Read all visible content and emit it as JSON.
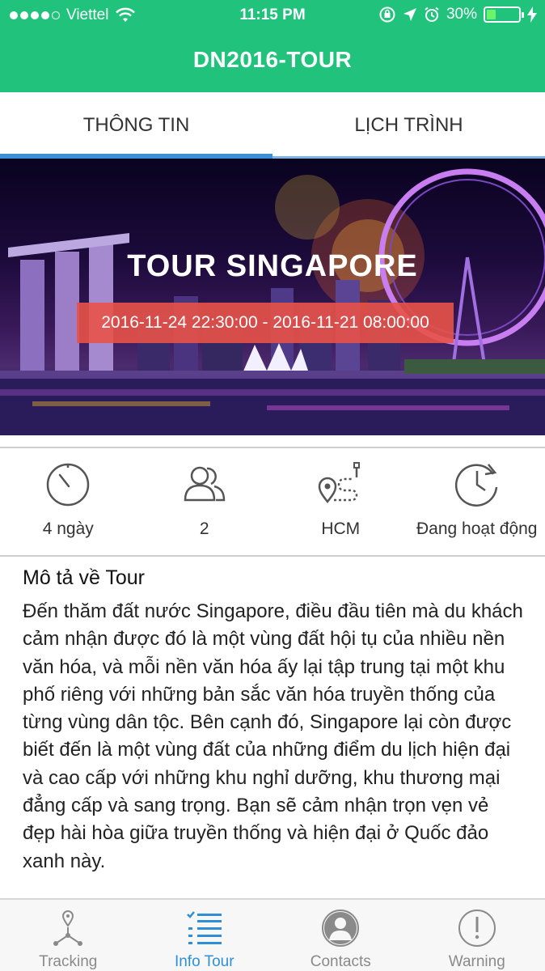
{
  "status_bar": {
    "carrier": "Viettel",
    "time": "11:15 PM",
    "battery_percent": "30%",
    "battery_level": 0.3,
    "signal_bars_filled": 4,
    "signal_bars_total": 5
  },
  "header": {
    "title": "DN2016-TOUR"
  },
  "tabs": [
    {
      "label": "THÔNG TIN",
      "active": true
    },
    {
      "label": "LỊCH TRÌNH",
      "active": false
    }
  ],
  "hero": {
    "title": "TOUR SINGAPORE",
    "dates": "2016-11-24 22:30:00 - 2016-11-21 08:00:00"
  },
  "stats": [
    {
      "icon": "stopwatch-icon",
      "label": "4 ngày"
    },
    {
      "icon": "people-icon",
      "label": "2"
    },
    {
      "icon": "route-icon",
      "label": "HCM"
    },
    {
      "icon": "clock-icon",
      "label": "Đang hoạt động"
    }
  ],
  "description": {
    "title": "Mô tả về Tour",
    "text": "Đến thăm đất nước Singapore, điều đầu tiên mà du khách cảm nhận được đó là một vùng đất hội tụ của nhiều nền văn hóa, và mỗi nền văn hóa ấy lại tập trung tại một khu phố riêng với những bản sắc văn hóa truyền thống của từng vùng dân tộc. Bên cạnh đó, Singapore lại còn được biết đến là một vùng đất của những điểm du lịch hiện đại và cao cấp với những khu nghỉ dưỡng, khu thương mại đẳng cấp và sang trọng. Bạn sẽ cảm nhận trọn vẹn vẻ đẹp hài hòa giữa truyền thống và hiện đại ở Quốc đảo xanh này."
  },
  "bottom_nav": [
    {
      "label": "Tracking",
      "icon": "tracking-icon",
      "active": false
    },
    {
      "label": "Info Tour",
      "icon": "list-icon",
      "active": true
    },
    {
      "label": "Contacts",
      "icon": "contact-icon",
      "active": false
    },
    {
      "label": "Warning",
      "icon": "warning-icon",
      "active": false
    }
  ],
  "colors": {
    "brand_green": "#21c37c",
    "tab_blue": "#3a8fd9",
    "date_badge_red": "#e85248",
    "nav_active": "#2f8fd6",
    "nav_inactive": "#8a8a8a"
  }
}
